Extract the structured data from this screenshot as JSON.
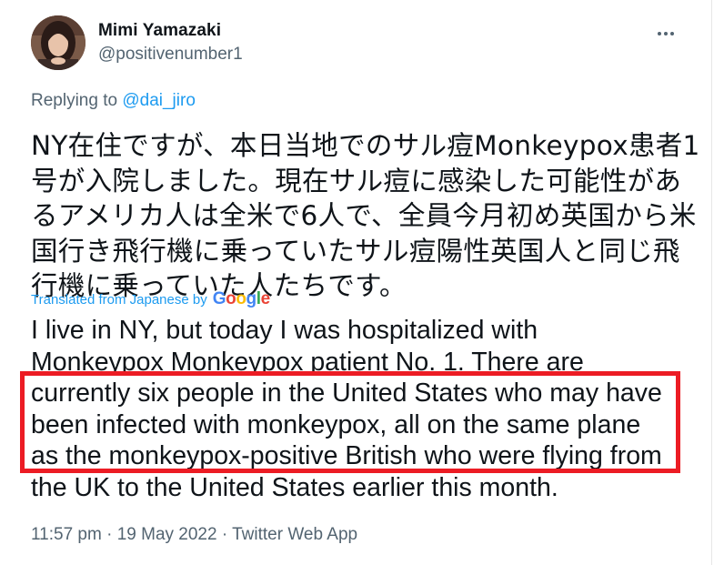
{
  "user": {
    "display_name": "Mimi Yamazaki",
    "handle": "@positivenumber1"
  },
  "more_label": "···",
  "reply": {
    "prefix": "Replying to ",
    "mention": "@dai_jiro"
  },
  "tweet": {
    "japanese_lines": [
      "NY在住ですが、本日当地でのサル痘Monkeypox患者1",
      "号が入院しました。現在サル痘に感染した可能性があ",
      "るアメリカ人は全米で6人で、全員今月初め英国から米",
      "国行き飛行機に乗っていたサル痘陽性英国人と同じ飛",
      "行機に乗っていた人たちです。"
    ],
    "translation_label": "Translated from Japanese by",
    "translation_provider": "Google",
    "english_lines": [
      "I live in NY, but today I was hospitalized with",
      "Monkeypox Monkeypox patient No. 1. There are",
      "currently six people in the United States who may have",
      "been infected with monkeypox, all on the same plane",
      "as the monkeypox-positive British who were flying from",
      "the UK to the United States earlier this month."
    ]
  },
  "meta": {
    "time": "11:57 pm",
    "sep1": " · ",
    "date": "19 May 2022",
    "sep2": " · ",
    "app": "Twitter Web App"
  },
  "colors": {
    "link": "#1d9bf0",
    "secondary_text": "#536471",
    "highlight_border": "#ec1c24"
  }
}
